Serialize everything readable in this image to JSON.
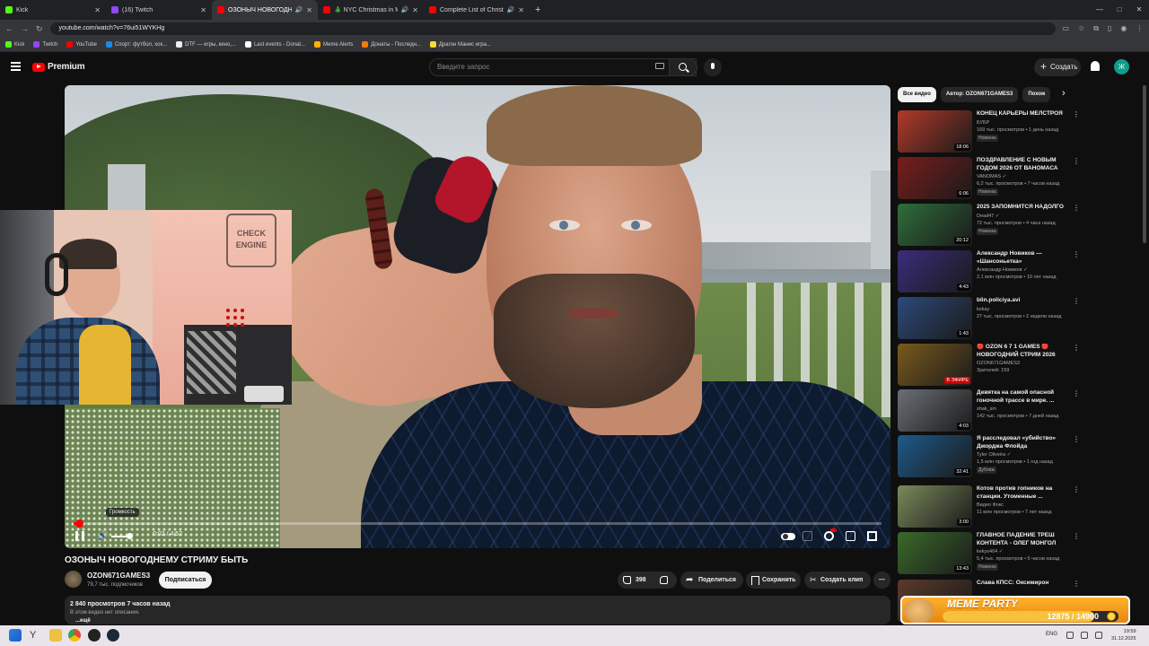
{
  "browser": {
    "tabs": [
      {
        "title": "Kick",
        "favicon_color": "#53fc18",
        "active": false,
        "playing": false
      },
      {
        "title": "(16) Twitch",
        "favicon_color": "#9146ff",
        "active": false,
        "playing": false
      },
      {
        "title": "ОЗОНЫЧ НОВОГОДНЕМУ",
        "favicon_color": "#ff0000",
        "active": true,
        "playing": true
      },
      {
        "title": "🎄 NYC Christmas in Manh",
        "favicon_color": "#ff0000",
        "active": false,
        "playing": true
      },
      {
        "title": "Complete List of Christmas",
        "favicon_color": "#ff0000",
        "active": false,
        "playing": true
      }
    ],
    "url": "youtube.com/watch?v=76ui51WYKHg",
    "bookmarks": [
      {
        "label": "Kick",
        "color": "#53fc18"
      },
      {
        "label": "Twitch",
        "color": "#9146ff"
      },
      {
        "label": "YouTube",
        "color": "#ff0000"
      },
      {
        "label": "Спорт: футбол, хок...",
        "color": "#1e88e5"
      },
      {
        "label": "DTF — игры, кино,...",
        "color": "#eeeeee"
      },
      {
        "label": "Last events - Donat...",
        "color": "#ffffff"
      },
      {
        "label": "Meme Alerts",
        "color": "#ffb300"
      },
      {
        "label": "Донаты - Последн...",
        "color": "#f57c00"
      },
      {
        "label": "Драгон Манис игра...",
        "color": "#fdd835"
      }
    ]
  },
  "youtube": {
    "logo_text": "Premium",
    "search_placeholder": "Введите запрос",
    "create_label": "Создать",
    "avatar_letter": "Ж"
  },
  "player": {
    "time": "0:02 / 4:52",
    "progress": 0.007,
    "volume": 0.85,
    "volume_tooltip": "Громкость"
  },
  "video": {
    "title": "ОЗОНЫЧ НОВОГОДНЕМУ СТРИМУ БЫТЬ",
    "channel": "OZON671GAMES3",
    "subscribers": "79,7 тыс. подписчиков",
    "subscribe_label": "Подписаться",
    "likes": "398",
    "share_label": "Поделиться",
    "save_label": "Сохранить",
    "clip_label": "Создать клип",
    "more_label": "⋯",
    "stats": "2 840 просмотров  7 часов назад",
    "description": "В этом видео нет описания.",
    "description_more": "...ещё"
  },
  "sidebar": {
    "chips": [
      {
        "label": "Все видео",
        "selected": true
      },
      {
        "label": "Автор: OZON671GAMES3",
        "selected": false
      },
      {
        "label": "Похож",
        "selected": false
      }
    ],
    "recommendations": [
      {
        "title": "КОНЕЦ КАРЬЕРЫ МЕЛСТРОЯ",
        "channel": "БУБР",
        "meta": "169 тыс. просмотров • 1 день назад",
        "badge": "Новинка",
        "duration": "18:06",
        "thumb": "#b23a2a"
      },
      {
        "title": "ПОЗДРАВЛЕНИЕ С НОВЫМ ГОДОМ 2026 ОТ ВАНОМАСА",
        "channel": "VANOMAS ✓",
        "meta": "6,2 тыс. просмотров • 7 часов назад",
        "badge": "Новинка",
        "duration": "6:06",
        "thumb": "#7a1d1d"
      },
      {
        "title": "2025 ЗАПОМНИТСЯ НАДОЛГО",
        "channel": "Dead47 ✓",
        "meta": "72 тыс. просмотров • 4 часа назад",
        "badge": "Новинка",
        "duration": "20:12",
        "thumb": "#2f6e3a"
      },
      {
        "title": "Александр Новиков — «Шансоньетка»",
        "channel": "Александр Новиков ✓",
        "meta": "2,1 млн просмотров • 10 лет назад",
        "badge": "",
        "duration": "4:43",
        "thumb": "#3b2d7a"
      },
      {
        "title": "blin.policiya.avi",
        "channel": "kekay",
        "meta": "27 тыс. просмотров • 2 недели назад",
        "badge": "",
        "duration": "1:43",
        "thumb": "#2d4a7a"
      },
      {
        "title": "🔴 OZON 6 7 1 GAMES 🔴 НОВОГОДНИЙ СТРИМ 2026",
        "channel": "OZON671GAMES3",
        "meta": "Зрителей: 159",
        "badge": "",
        "duration": "В ЭФИРЕ",
        "thumb": "#7a5a1d"
      },
      {
        "title": "Девятка на самой опасной гоночной трассе в мире. ...",
        "channel": "shak_sm",
        "meta": "142 тыс. просмотров • 7 дней назад",
        "badge": "",
        "duration": "4:03",
        "thumb": "#6b6f75"
      },
      {
        "title": "Я расследовал «убийство» Джорджа Флойда",
        "channel": "Tyler Oliveira ✓",
        "meta": "1,5 млн просмотров • 1 год назад",
        "badge": "Дубляж",
        "duration": "32:41",
        "thumb": "#1e5a8a"
      },
      {
        "title": "Котов против гопников на станции. Утоменные ...",
        "channel": "Видео Фокс",
        "meta": "11 млн просмотров • 7 лет назад",
        "badge": "",
        "duration": "3:00",
        "thumb": "#7a8a5a"
      },
      {
        "title": "ГЛАВНОЕ ПАДЕНИЕ ТРЕШ КОНТЕНТА - ОЛЕГ МОНГОЛ",
        "channel": "kekys404 ✓",
        "meta": "5,4 тыс. просмотров • 5 часов назад",
        "badge": "Новинка",
        "duration": "13:43",
        "thumb": "#3a6a2a"
      },
      {
        "title": "Слава КПСС: Оксимирон",
        "channel": "",
        "meta": "",
        "badge": "",
        "duration": "",
        "thumb": "#5a3a2a"
      }
    ]
  },
  "meme_alert": {
    "title": "MEME PARTY",
    "current": 12875,
    "goal": 14900,
    "count_text": "12875 / 14900"
  },
  "taskbar": {
    "lang": "ENG",
    "time": "19:59",
    "date": "31.12.2025"
  }
}
